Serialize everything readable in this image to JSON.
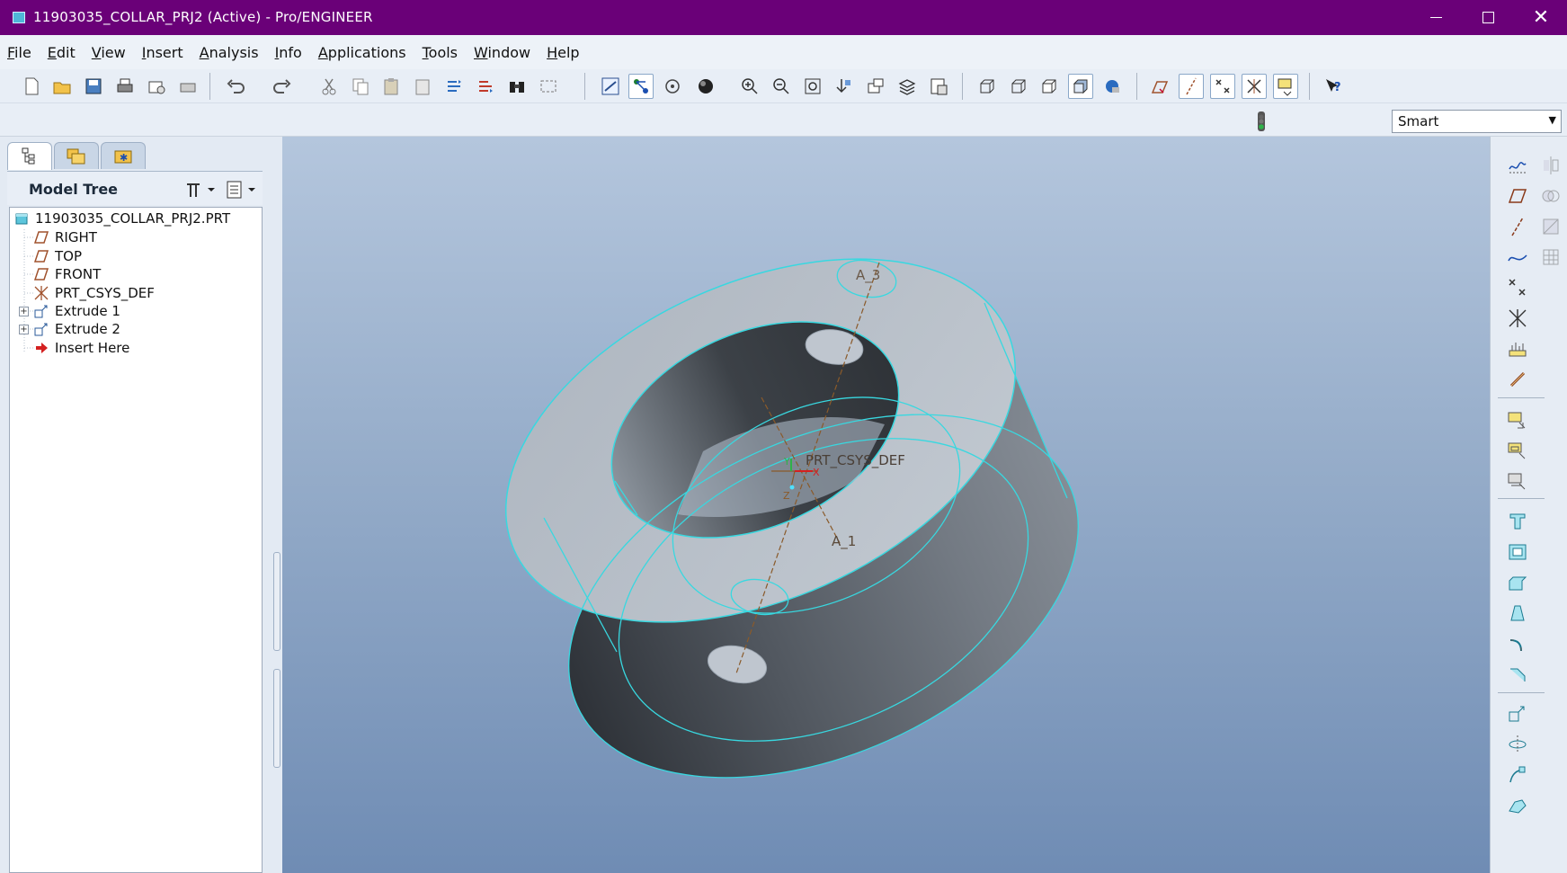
{
  "window": {
    "title": "11903035_COLLAR_PRJ2 (Active) - Pro/ENGINEER"
  },
  "menu": [
    {
      "label": "File",
      "accel": "F"
    },
    {
      "label": "Edit",
      "accel": "E"
    },
    {
      "label": "View",
      "accel": "V"
    },
    {
      "label": "Insert",
      "accel": "I"
    },
    {
      "label": "Analysis",
      "accel": "A"
    },
    {
      "label": "Info",
      "accel": "I"
    },
    {
      "label": "Applications",
      "accel": "A"
    },
    {
      "label": "Tools",
      "accel": "T"
    },
    {
      "label": "Window",
      "accel": "W"
    },
    {
      "label": "Help",
      "accel": "H"
    }
  ],
  "filter": {
    "value": "Smart"
  },
  "left_panel": {
    "tabs": [
      "model-tree-tab",
      "folder-browser-tab",
      "favorites-tab"
    ],
    "header": "Model Tree",
    "tree": [
      {
        "label": "11903035_COLLAR_PRJ2.PRT",
        "icon": "part-icon",
        "expandable": false
      },
      {
        "label": "RIGHT",
        "icon": "datum-plane-icon",
        "expandable": false
      },
      {
        "label": "TOP",
        "icon": "datum-plane-icon",
        "expandable": false
      },
      {
        "label": "FRONT",
        "icon": "datum-plane-icon",
        "expandable": false
      },
      {
        "label": "PRT_CSYS_DEF",
        "icon": "csys-icon",
        "expandable": false
      },
      {
        "label": "Extrude 1",
        "icon": "extrude-icon",
        "expandable": true
      },
      {
        "label": "Extrude 2",
        "icon": "extrude-icon",
        "expandable": true
      },
      {
        "label": "Insert Here",
        "icon": "insert-arrow-icon",
        "expandable": false
      }
    ]
  },
  "viewport": {
    "axis_labels": {
      "a3": "A_3",
      "a1": "A_1",
      "csys": "PRT_CSYS_DEF",
      "csys_z": "Z",
      "csys_y": "Y",
      "csys_x": "X"
    },
    "colors": {
      "edge": "#38d8e0",
      "face_light": "#b9c1cb",
      "face_dark": "#3e4349",
      "axis": "#8a5a2a"
    }
  }
}
